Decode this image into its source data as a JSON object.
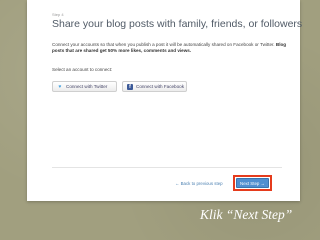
{
  "page": {
    "step_label": "Step 4",
    "title": "Share your blog posts with family, friends, or followers",
    "description_part1": "Connect your accounts so that when you publish a post it will be automatically shared on Facebook or Twitter.",
    "description_bold": "Blog posts that are shared get 50% more likes, comments and views.",
    "select_label": "Select an account to connect:",
    "twitter_button": "Connect with Twitter",
    "facebook_button": "Connect with Facebook",
    "back_link": "← Back to previous step",
    "next_button": "Next Step →"
  },
  "caption": "Klik “Next Step”",
  "colors": {
    "accent": "#4f8fd0",
    "highlight": "#e53b1c",
    "background": "#a19f7f"
  },
  "icons": {
    "twitter": "twitter-bird-icon",
    "facebook": "facebook-f-icon"
  }
}
